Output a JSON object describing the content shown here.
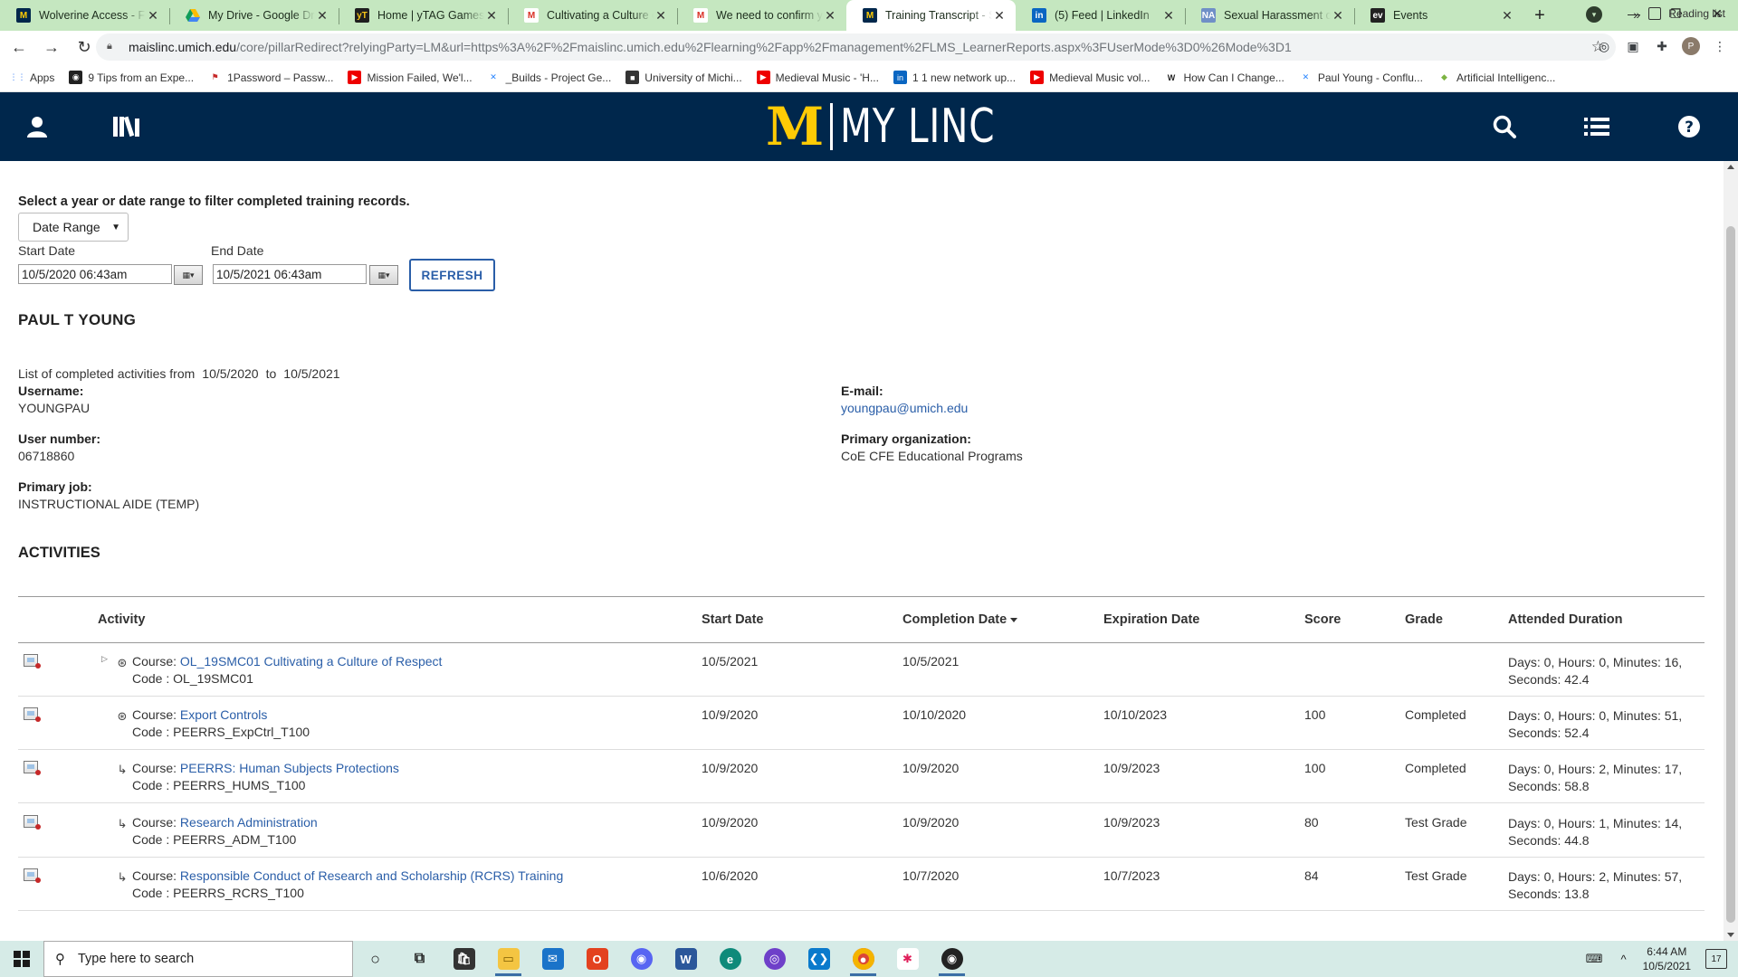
{
  "browser": {
    "tabs": [
      {
        "title": "Wolverine Access - Fin",
        "favicon": "umich-m-icon",
        "fav_text": "M",
        "fav_class": "fav-m",
        "active": false
      },
      {
        "title": "My Drive - Google Dri",
        "favicon": "google-drive-icon",
        "fav_text": "",
        "fav_class": "fav-drive",
        "active": false
      },
      {
        "title": "Home | yTAG Games",
        "favicon": "ytag-icon",
        "fav_text": "yT",
        "fav_class": "fav-ytag",
        "active": false
      },
      {
        "title": "Cultivating a Culture o",
        "favicon": "gmail-icon",
        "fav_text": "M",
        "fav_class": "fav-gmail",
        "active": false
      },
      {
        "title": "We need to confirm yo",
        "favicon": "gmail-icon",
        "fav_text": "M",
        "fav_class": "fav-gmail",
        "active": false
      },
      {
        "title": "Training Transcript - St",
        "favicon": "umich-m-icon",
        "fav_text": "M",
        "fav_class": "fav-m",
        "active": true
      },
      {
        "title": "(5) Feed | LinkedIn",
        "favicon": "linkedin-icon",
        "fav_text": "in",
        "fav_class": "fav-li",
        "active": false
      },
      {
        "title": "Sexual Harassment of",
        "favicon": "nap-icon",
        "fav_text": "NA",
        "fav_class": "fav-na",
        "active": false
      },
      {
        "title": "Events",
        "favicon": "events-icon",
        "fav_text": "ev",
        "fav_class": "fav-ev",
        "active": false
      }
    ],
    "url_host": "maislinc.umich.edu",
    "url_path": "/core/pillarRedirect?relyingParty=LM&url=https%3A%2F%2Fmaislinc.umich.edu%2Flearning%2Fapp%2Fmanagement%2FLMS_LearnerReports.aspx%3FUserMode%3D0%26Mode%3D1",
    "bookmarks": [
      {
        "label": "Apps",
        "icon": "apps-grid-icon",
        "glyph": "⋮⋮",
        "cls": "ico-apps"
      },
      {
        "label": "9 Tips from an Expe...",
        "icon": "globe-icon",
        "glyph": "◉",
        "cls": "ico-circ"
      },
      {
        "label": "1Password – Passw...",
        "icon": "onepassword-icon",
        "glyph": "⚑",
        "cls": "ico-1p"
      },
      {
        "label": "Mission Failed, We'l...",
        "icon": "youtube-icon",
        "glyph": "▶",
        "cls": "ico-yt"
      },
      {
        "label": "_Builds - Project Ge...",
        "icon": "jira-icon",
        "glyph": "✕",
        "cls": "ico-jira"
      },
      {
        "label": "University of Michi...",
        "icon": "cube-icon",
        "glyph": "■",
        "cls": "ico-cube"
      },
      {
        "label": "Medieval Music - 'H...",
        "icon": "youtube-icon",
        "glyph": "▶",
        "cls": "ico-yt"
      },
      {
        "label": "1 1 new network up...",
        "icon": "linkedin-icon",
        "glyph": "in",
        "cls": "ico-li"
      },
      {
        "label": "Medieval Music vol...",
        "icon": "youtube-icon",
        "glyph": "▶",
        "cls": "ico-yt"
      },
      {
        "label": "How Can I Change...",
        "icon": "wikipedia-icon",
        "glyph": "W",
        "cls": "ico-w"
      },
      {
        "label": "Paul Young - Conflu...",
        "icon": "confluence-icon",
        "glyph": "✕",
        "cls": "ico-jira"
      },
      {
        "label": "Artificial Intelligenc...",
        "icon": "ai-icon",
        "glyph": "◆",
        "cls": "ico-ai"
      }
    ],
    "bookmarks_more": "»",
    "reading_list": "Reading list"
  },
  "site": {
    "logo_m": "M",
    "logo_text": "MY LINC"
  },
  "filters": {
    "prompt": "Select a year or date range to filter completed training records.",
    "mode": "Date Range",
    "start_label": "Start Date",
    "start_value": "10/5/2020 06:43am",
    "end_label": "End Date",
    "end_value": "10/5/2021 06:43am",
    "refresh_label": "REFRESH"
  },
  "learner": {
    "name": "PAUL T YOUNG",
    "period_prefix": "List of completed activities from",
    "period_from": "10/5/2020",
    "period_to_word": "to",
    "period_to": "10/5/2021",
    "username_label": "Username:",
    "username": "YOUNGPAU",
    "user_number_label": "User number:",
    "user_number": "06718860",
    "primary_job_label": "Primary job:",
    "primary_job": "INSTRUCTIONAL AIDE (TEMP)",
    "email_label": "E-mail:",
    "email": "youngpau@umich.edu",
    "primary_org_label": "Primary organization:",
    "primary_org": "CoE CFE Educational Programs"
  },
  "activities": {
    "title": "ACTIVITIES",
    "headers": {
      "activity": "Activity",
      "start": "Start Date",
      "completion": "Completion Date",
      "expiration": "Expiration Date",
      "score": "Score",
      "grade": "Grade",
      "duration": "Attended Duration"
    },
    "rows": [
      {
        "prefix": "Course:",
        "title": "OL_19SMC01 Cultivating a Culture of Respect",
        "code": "Code : OL_19SMC01",
        "start": "10/5/2021",
        "completion": "10/5/2021",
        "expiration": "",
        "score": "",
        "grade": "",
        "duration": "Days: 0, Hours: 0, Minutes: 16, Seconds: 42.4",
        "type_icon": "online-course-icon",
        "expandable": true
      },
      {
        "prefix": "Course:",
        "title": "Export Controls",
        "code": "Code : PEERRS_ExpCtrl_T100",
        "start": "10/9/2020",
        "completion": "10/10/2020",
        "expiration": "10/10/2023",
        "score": "100",
        "grade": "Completed",
        "duration": "Days: 0, Hours: 0, Minutes: 51, Seconds: 52.4",
        "type_icon": "online-course-icon",
        "expandable": false
      },
      {
        "prefix": "Course:",
        "title": "PEERRS: Human Subjects Protections",
        "code": "Code : PEERRS_HUMS_T100",
        "start": "10/9/2020",
        "completion": "10/9/2020",
        "expiration": "10/9/2023",
        "score": "100",
        "grade": "Completed",
        "duration": "Days: 0, Hours: 2, Minutes: 17, Seconds: 58.8",
        "type_icon": "curriculum-icon",
        "expandable": false
      },
      {
        "prefix": "Course:",
        "title": "Research Administration",
        "code": "Code : PEERRS_ADM_T100",
        "start": "10/9/2020",
        "completion": "10/9/2020",
        "expiration": "10/9/2023",
        "score": "80",
        "grade": "Test Grade",
        "duration": "Days: 0, Hours: 1, Minutes: 14, Seconds: 44.8",
        "type_icon": "curriculum-icon",
        "expandable": false
      },
      {
        "prefix": "Course:",
        "title": "Responsible Conduct of Research and Scholarship (RCRS) Training",
        "code": "Code : PEERRS_RCRS_T100",
        "start": "10/6/2020",
        "completion": "10/7/2020",
        "expiration": "10/7/2023",
        "score": "84",
        "grade": "Test Grade",
        "duration": "Days: 0, Hours: 2, Minutes: 57, Seconds: 13.8",
        "type_icon": "curriculum-icon",
        "expandable": false
      }
    ]
  },
  "taskbar": {
    "search_placeholder": "Type here to search",
    "time": "6:44 AM",
    "date": "10/5/2021",
    "notifications": "17"
  },
  "colors": {
    "brand_navy": "#00274c",
    "brand_maize": "#ffcb05",
    "link_blue": "#2a5ea8",
    "tabstrip_green": "#c5e7c0"
  }
}
